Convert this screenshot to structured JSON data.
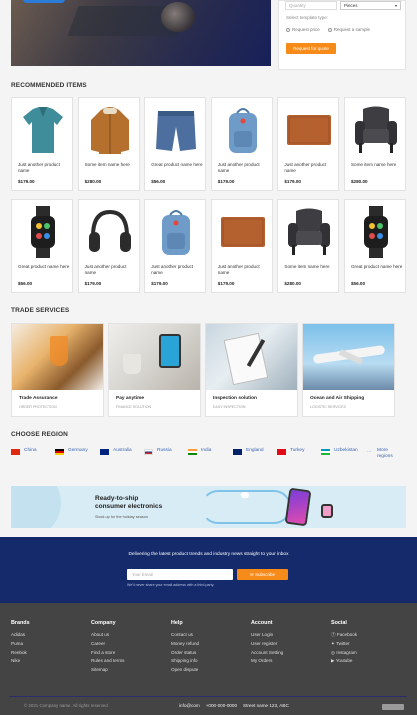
{
  "quote_form": {
    "quantity_placeholder": "Quantity",
    "unit_selected": "Pieces",
    "template_label": "Select template type:",
    "radio_price": "Request price",
    "radio_sample": "Request a sample",
    "submit_label": "Request for quote"
  },
  "recommended": {
    "title": "RECOMMENDED ITEMS",
    "items": [
      {
        "name": "Just another product name",
        "price": "$179.00",
        "icon": "polo-shirt-icon"
      },
      {
        "name": "Some item name here",
        "price": "$280.00",
        "icon": "jacket-icon"
      },
      {
        "name": "Great product name here",
        "price": "$56.00",
        "icon": "shorts-icon"
      },
      {
        "name": "Just another product name",
        "price": "$179.00",
        "icon": "backpack-icon"
      },
      {
        "name": "Just another product name",
        "price": "$179.00",
        "icon": "wallet-icon"
      },
      {
        "name": "Some item name here",
        "price": "$280.00",
        "icon": "armchair-icon"
      },
      {
        "name": "Great product name here",
        "price": "$56.00",
        "icon": "smartwatch-icon"
      },
      {
        "name": "Just another product name",
        "price": "$179.00",
        "icon": "headphones-icon"
      },
      {
        "name": "Just another product name",
        "price": "$179.00",
        "icon": "backpack-icon"
      },
      {
        "name": "Just another product name",
        "price": "$179.00",
        "icon": "wallet-icon"
      },
      {
        "name": "Some item name here",
        "price": "$280.00",
        "icon": "armchair-icon"
      },
      {
        "name": "Great product name here",
        "price": "$56.00",
        "icon": "smartwatch-icon"
      }
    ]
  },
  "trade_services": {
    "title": "TRADE SERVICES",
    "items": [
      {
        "title": "Trade Assurance",
        "subtitle": "ORDER PROTECTION"
      },
      {
        "title": "Pay anytime",
        "subtitle": "FINANCE SOLUTION"
      },
      {
        "title": "Inspection solution",
        "subtitle": "EASY INSPECTION"
      },
      {
        "title": "Ocean and Air Shipping",
        "subtitle": "LOGISTIC SERVICES"
      }
    ]
  },
  "regions": {
    "title": "CHOOSE REGION",
    "items": [
      {
        "name": "China",
        "flag": "china-flag"
      },
      {
        "name": "Germany",
        "flag": "germany-flag"
      },
      {
        "name": "Australia",
        "flag": "australia-flag"
      },
      {
        "name": "Russia",
        "flag": "russia-flag"
      },
      {
        "name": "India",
        "flag": "india-flag"
      },
      {
        "name": "England",
        "flag": "england-flag"
      },
      {
        "name": "Turkey",
        "flag": "turkey-flag"
      },
      {
        "name": "Uzbekistan",
        "flag": "uzbekistan-flag"
      },
      {
        "name": "More regions",
        "flag": "more-icon"
      }
    ]
  },
  "ad_banner": {
    "line1": "Ready-to-ship",
    "line2": "consumer electronics",
    "line3": "Stock up for the holiday season"
  },
  "newsletter": {
    "text": "Delivering the latest product trends and industry news straight to your inbox",
    "email_placeholder": "Your Email",
    "subscribe_label": "Subscribe",
    "note": "We'll never share your email address with a third-party."
  },
  "footer": {
    "columns": [
      {
        "title": "Brands",
        "links": [
          "Adidas",
          "Puma",
          "Reebok",
          "Nike"
        ]
      },
      {
        "title": "Company",
        "links": [
          "About us",
          "Career",
          "Find a store",
          "Rules and terms",
          "Sitemap"
        ]
      },
      {
        "title": "Help",
        "links": [
          "Contact us",
          "Money refund",
          "Order status",
          "Shipping info",
          "Open dispute"
        ]
      },
      {
        "title": "Account",
        "links": [
          "User Login",
          "User register",
          "Account Setting",
          "My Orders"
        ]
      },
      {
        "title": "Social",
        "links": [
          "Facebook",
          "Twitter",
          "Instagram",
          "Youtube"
        ]
      }
    ],
    "copyright": "© 2021 Company name. All rights reserved",
    "contact": [
      "info@com",
      "+000-000-0000",
      "Street name 123, ABC"
    ]
  },
  "colors": {
    "accent": "#f78b1a",
    "link": "#3a66b5",
    "newsletter_bg": "#152a6a",
    "footer_bg": "#444444"
  }
}
